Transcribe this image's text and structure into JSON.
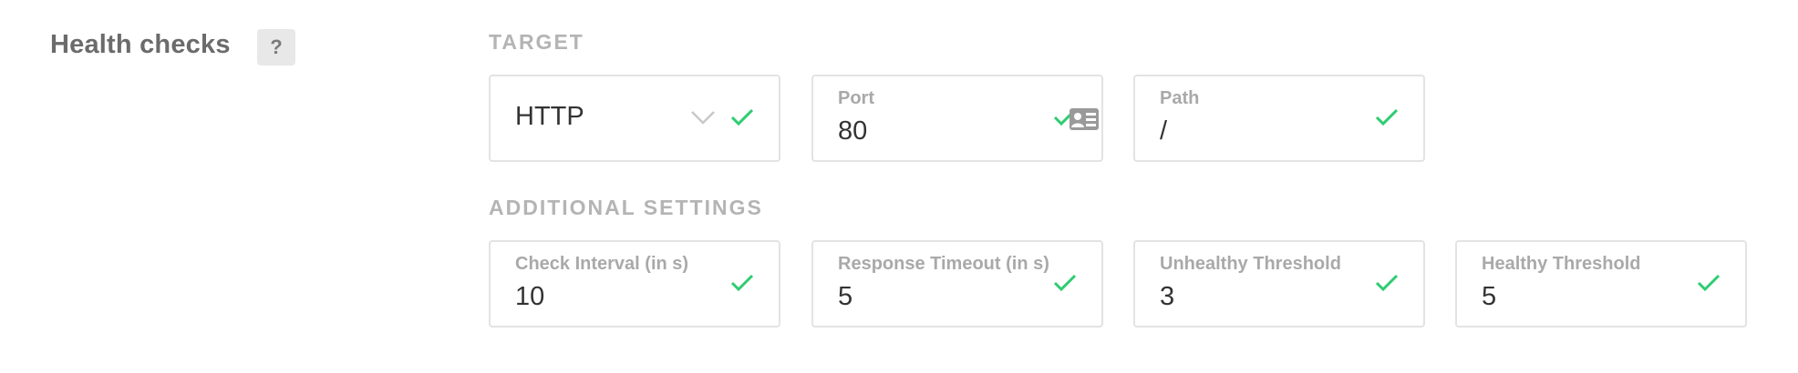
{
  "section": {
    "title": "Health checks",
    "help_label": "?"
  },
  "target": {
    "heading": "TARGET",
    "protocol": {
      "value": "HTTP",
      "icon": "chevron-down-icon"
    },
    "port": {
      "label": "Port",
      "value": "80"
    },
    "path": {
      "label": "Path",
      "value": "/"
    }
  },
  "additional": {
    "heading": "ADDITIONAL SETTINGS",
    "check_interval": {
      "label": "Check Interval (in s)",
      "value": "10"
    },
    "response_timeout": {
      "label": "Response Timeout (in s)",
      "value": "5"
    },
    "unhealthy_threshold": {
      "label": "Unhealthy Threshold",
      "value": "3"
    },
    "healthy_threshold": {
      "label": "Healthy Threshold",
      "value": "5"
    }
  },
  "colors": {
    "valid_check": "#2ecc71",
    "border": "#e3e3e3",
    "muted_text": "#a9a9a9"
  }
}
